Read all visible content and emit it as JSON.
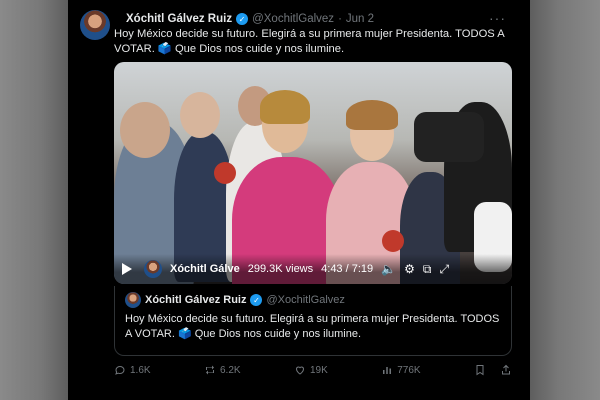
{
  "tweet": {
    "author_name": "Xóchitl Gálvez Ruiz",
    "handle": "@XochitlGalvez",
    "separator": "·",
    "date": "Jun 2",
    "more": "···",
    "text": "Hoy México decide su futuro. Elegirá a su primera mujer Presidenta. TODOS A VOTAR. 🗳️ Que Dios nos cuide y nos ilumine."
  },
  "video": {
    "channel_name": "Xóchitl Gálve",
    "views": "299.3K views",
    "time": "4:43 / 7:19"
  },
  "quote": {
    "author_name": "Xóchitl Gálvez Ruiz",
    "handle": "@XochitlGalvez",
    "text": "Hoy México decide su futuro. Elegirá a su primera mujer Presidenta. TODOS A VOTAR. 🗳️ Que Dios nos cuide y nos ilumine."
  },
  "actions": {
    "replies": "1.6K",
    "reposts": "6.2K",
    "likes": "19K",
    "views": "776K"
  },
  "colors": {
    "background": "#000000",
    "accent": "#1d9bf0",
    "muted": "#71767b"
  }
}
